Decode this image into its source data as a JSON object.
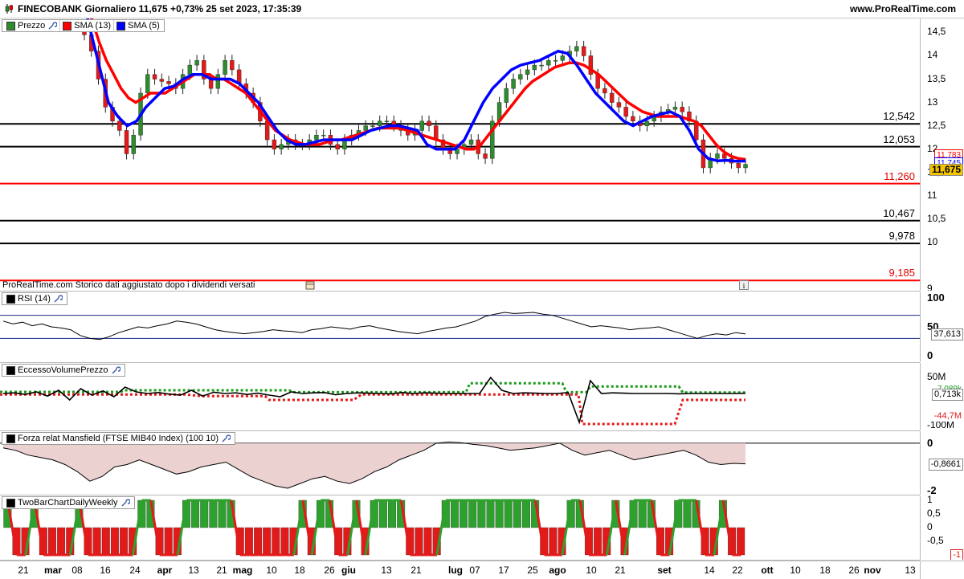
{
  "header": {
    "title": "FINECOBANK Giornaliero 11,675 +0,73% 25 set 2023, 17:35:39",
    "site": "www.ProRealTime.com"
  },
  "price_panel": {
    "legend": [
      {
        "label": "Prezzo",
        "color": "#2e8b2e"
      },
      {
        "label": "SMA (13)",
        "color": "#ff0000"
      },
      {
        "label": "SMA (5)",
        "color": "#0000ff"
      }
    ],
    "note": "ProRealTime.com  Storico dati aggiustato dopo i dividendi versati",
    "last_price_tag": "11,675",
    "sma13_tag": "11,783",
    "sma5_tag": "11,745"
  },
  "rsi_panel": {
    "legend": "RSI (14)",
    "tag": "37,613"
  },
  "evp_panel": {
    "legend": "EccessoVolumePrezzo",
    "tags": [
      "7,089k",
      "0,713k",
      "-44,7M"
    ]
  },
  "mansfield_panel": {
    "legend": "Forza relat Mansfield (FTSE MIB40 Index) (100 10)",
    "tag": "-0,8661"
  },
  "twobar_panel": {
    "legend": "TwoBarChartDailyWeekly",
    "tag": "-1"
  },
  "date_labels": [
    {
      "t": "21",
      "x": 29,
      "bold": false
    },
    {
      "t": "mar",
      "x": 66,
      "bold": true
    },
    {
      "t": "08",
      "x": 96,
      "bold": false
    },
    {
      "t": "16",
      "x": 131,
      "bold": false
    },
    {
      "t": "24",
      "x": 168,
      "bold": false
    },
    {
      "t": "apr",
      "x": 205,
      "bold": true
    },
    {
      "t": "13",
      "x": 241,
      "bold": false
    },
    {
      "t": "21",
      "x": 276,
      "bold": false
    },
    {
      "t": "mag",
      "x": 302,
      "bold": true
    },
    {
      "t": "10",
      "x": 338,
      "bold": false
    },
    {
      "t": "18",
      "x": 373,
      "bold": false
    },
    {
      "t": "26",
      "x": 410,
      "bold": false
    },
    {
      "t": "giu",
      "x": 434,
      "bold": true
    },
    {
      "t": "13",
      "x": 481,
      "bold": false
    },
    {
      "t": "21",
      "x": 518,
      "bold": false
    },
    {
      "t": "lug",
      "x": 567,
      "bold": true
    },
    {
      "t": "07",
      "x": 591,
      "bold": false
    },
    {
      "t": "17",
      "x": 627,
      "bold": false
    },
    {
      "t": "25",
      "x": 663,
      "bold": false
    },
    {
      "t": "ago",
      "x": 694,
      "bold": true
    },
    {
      "t": "10",
      "x": 736,
      "bold": false
    },
    {
      "t": "21",
      "x": 772,
      "bold": false
    },
    {
      "t": "set",
      "x": 827,
      "bold": true
    },
    {
      "t": "14",
      "x": 883,
      "bold": false
    },
    {
      "t": "22",
      "x": 918,
      "bold": false
    },
    {
      "t": "ott",
      "x": 955,
      "bold": true
    },
    {
      "t": "10",
      "x": 990,
      "bold": false
    },
    {
      "t": "18",
      "x": 1027,
      "bold": false
    },
    {
      "t": "26",
      "x": 1063,
      "bold": false
    },
    {
      "t": "nov",
      "x": 1086,
      "bold": true
    },
    {
      "t": "13",
      "x": 1133,
      "bold": false
    }
  ],
  "chart_data": [
    {
      "type": "candlestick",
      "ylim": [
        9,
        14.8
      ],
      "y_ticks": [
        "14,5",
        "14",
        "13,5",
        "13",
        "12,5",
        "12",
        "11,5",
        "11",
        "10,5",
        "10",
        "9"
      ],
      "y_tick_values": [
        14.5,
        14,
        13.5,
        13,
        12.5,
        12,
        11.5,
        11,
        10.5,
        10,
        9
      ],
      "levels": [
        {
          "value": 12.542,
          "label": "12,542",
          "color": "#000000"
        },
        {
          "value": 12.053,
          "label": "12,053",
          "color": "#000000"
        },
        {
          "value": 11.26,
          "label": "11,260",
          "color": "#ff0000"
        },
        {
          "value": 10.467,
          "label": "10,467",
          "color": "#000000"
        },
        {
          "value": 9.978,
          "label": "9,978",
          "color": "#000000"
        },
        {
          "value": 9.185,
          "label": "9,185",
          "color": "#ff0000"
        }
      ],
      "close": [
        14.45,
        14.1,
        13.5,
        12.9,
        12.6,
        12.4,
        11.9,
        12.3,
        13.2,
        13.6,
        13.5,
        13.45,
        13.4,
        13.3,
        13.6,
        13.8,
        13.9,
        13.5,
        13.3,
        13.6,
        13.9,
        13.7,
        13.4,
        13.2,
        13.0,
        12.6,
        12.2,
        12.0,
        12.1,
        12.2,
        12.1,
        12.1,
        12.2,
        12.3,
        12.3,
        12.1,
        12.0,
        12.2,
        12.3,
        12.4,
        12.5,
        12.5,
        12.6,
        12.6,
        12.5,
        12.4,
        12.3,
        12.4,
        12.6,
        12.5,
        12.2,
        12.0,
        11.9,
        12.0,
        12.1,
        12.2,
        11.9,
        11.8,
        12.6,
        13.0,
        13.3,
        13.5,
        13.6,
        13.7,
        13.8,
        13.8,
        13.9,
        13.9,
        14.0,
        14.1,
        14.2,
        14.0,
        13.6,
        13.3,
        13.2,
        13.0,
        12.9,
        12.7,
        12.6,
        12.5,
        12.6,
        12.7,
        12.8,
        12.85,
        12.9,
        12.8,
        12.6,
        12.2,
        11.6,
        11.8,
        11.9,
        11.8,
        11.7,
        11.6,
        11.675
      ],
      "sma13": [
        15.2,
        14.8,
        14.3,
        13.9,
        13.6,
        13.3,
        13.1,
        13.0,
        13.1,
        13.2,
        13.2,
        13.2,
        13.3,
        13.4,
        13.5,
        13.6,
        13.6,
        13.6,
        13.5,
        13.5,
        13.4,
        13.3,
        13.2,
        13.0,
        12.8,
        12.6,
        12.4,
        12.3,
        12.2,
        12.15,
        12.1,
        12.1,
        12.1,
        12.15,
        12.2,
        12.2,
        12.25,
        12.3,
        12.35,
        12.4,
        12.45,
        12.45,
        12.45,
        12.45,
        12.4,
        12.35,
        12.3,
        12.25,
        12.2,
        12.15,
        12.1,
        12.05,
        12.0,
        12.0,
        12.1,
        12.3,
        12.5,
        12.7,
        12.9,
        13.1,
        13.3,
        13.45,
        13.55,
        13.65,
        13.75,
        13.8,
        13.85,
        13.85,
        13.8,
        13.7,
        13.6,
        13.45,
        13.3,
        13.15,
        13.0,
        12.9,
        12.8,
        12.75,
        12.7,
        12.7,
        12.7,
        12.7,
        12.65,
        12.6,
        12.5,
        12.3,
        12.1,
        11.95,
        11.85,
        11.8,
        11.78
      ],
      "sma5": [
        15.5,
        14.6,
        13.8,
        13.0,
        12.7,
        12.5,
        12.6,
        12.9,
        13.1,
        13.3,
        13.35,
        13.5,
        13.6,
        13.6,
        13.5,
        13.5,
        13.5,
        13.4,
        13.2,
        13.0,
        12.7,
        12.4,
        12.2,
        12.1,
        12.1,
        12.15,
        12.2,
        12.2,
        12.2,
        12.2,
        12.3,
        12.4,
        12.45,
        12.5,
        12.5,
        12.45,
        12.4,
        12.1,
        12.0,
        12.0,
        12.0,
        12.2,
        12.6,
        13.0,
        13.3,
        13.5,
        13.7,
        13.8,
        13.85,
        13.9,
        14.0,
        14.1,
        14.05,
        13.8,
        13.5,
        13.2,
        13.0,
        12.8,
        12.6,
        12.5,
        12.6,
        12.7,
        12.75,
        12.8,
        12.7,
        12.4,
        12.0,
        11.8,
        11.75,
        11.76,
        11.74,
        11.745
      ]
    },
    {
      "type": "line",
      "name": "RSI (14)",
      "ylim": [
        0,
        100
      ],
      "y_ticks": [
        "100",
        "50",
        "0"
      ],
      "y_tick_values": [
        100,
        50,
        0
      ],
      "levels": [
        70,
        30
      ],
      "values": [
        60,
        55,
        58,
        52,
        55,
        50,
        48,
        45,
        35,
        30,
        28,
        33,
        40,
        45,
        50,
        48,
        52,
        55,
        60,
        58,
        55,
        50,
        45,
        42,
        40,
        38,
        40,
        42,
        45,
        43,
        42,
        40,
        45,
        47,
        50,
        48,
        46,
        50,
        52,
        48,
        45,
        42,
        40,
        38,
        42,
        45,
        48,
        50,
        55,
        60,
        68,
        72,
        75,
        73,
        74,
        75,
        72,
        70,
        65,
        60,
        55,
        50,
        52,
        50,
        48,
        45,
        47,
        48,
        50,
        45,
        40,
        35,
        30,
        35,
        38,
        36,
        40,
        37.6
      ]
    },
    {
      "type": "line",
      "name": "EccessoVolumePrezzo",
      "ylim": [
        -100,
        50
      ],
      "y_ticks": [
        "50M",
        "-100M"
      ],
      "y_tick_values": [
        50,
        -100
      ],
      "values": [
        0,
        2,
        -3,
        5,
        -8,
        10,
        -20,
        15,
        -5,
        8,
        -10,
        20,
        5,
        0,
        3,
        -2,
        -5,
        10,
        -8,
        4,
        0,
        2,
        -3,
        1,
        -5,
        -10,
        5,
        0,
        2,
        3,
        -4,
        0,
        2,
        1,
        0,
        -1,
        3,
        0,
        2,
        1,
        0,
        0,
        0,
        0,
        50,
        10,
        0,
        2,
        1,
        0,
        0,
        3,
        -90,
        40,
        0,
        2,
        1,
        0,
        0,
        0,
        0,
        -1,
        0,
        0,
        0,
        0,
        0,
        0.7
      ]
    },
    {
      "type": "area",
      "name": "Forza relat Mansfield",
      "ylim": [
        -2,
        0.2
      ],
      "y_ticks": [
        "0",
        "-2"
      ],
      "y_tick_values": [
        0,
        -2
      ],
      "values": [
        -0.2,
        -0.3,
        -0.5,
        -0.6,
        -0.7,
        -0.9,
        -1.2,
        -1.6,
        -1.4,
        -1.0,
        -0.9,
        -0.7,
        -0.9,
        -1.1,
        -1.3,
        -1.2,
        -1.0,
        -0.9,
        -0.8,
        -1.1,
        -1.4,
        -1.6,
        -1.8,
        -1.9,
        -1.7,
        -1.5,
        -1.4,
        -1.6,
        -1.7,
        -1.5,
        -1.2,
        -1.0,
        -0.7,
        -0.5,
        -0.3,
        0.0,
        0.05,
        0.02,
        -0.05,
        -0.1,
        -0.2,
        -0.3,
        -0.25,
        -0.2,
        -0.1,
        0.0,
        -0.3,
        -0.5,
        -0.4,
        -0.3,
        -0.5,
        -0.7,
        -0.6,
        -0.5,
        -0.4,
        -0.3,
        -0.5,
        -0.8,
        -0.9,
        -0.85,
        -0.87
      ]
    },
    {
      "type": "bar",
      "name": "TwoBarChartDailyWeekly",
      "ylim": [
        -1,
        1
      ],
      "y_ticks": [
        "1",
        "0,5",
        "0",
        "-0,5"
      ],
      "y_tick_values": [
        1,
        0.5,
        0,
        -0.5
      ],
      "values": [
        1,
        -1,
        -1,
        1,
        -1,
        -1,
        -1,
        -1,
        1,
        -1,
        -1,
        -1,
        -1,
        -1,
        -1,
        1,
        1,
        -1,
        -1,
        -1,
        1,
        1,
        1,
        1,
        1,
        1,
        -1,
        -1,
        -1,
        -1,
        -1,
        -1,
        -1,
        1,
        -1,
        1,
        1,
        -1,
        -1,
        1,
        -1,
        1,
        1,
        1,
        1,
        -1,
        -1,
        -1,
        -1,
        1,
        1,
        1,
        1,
        1,
        1,
        1,
        1,
        1,
        1,
        1,
        -1,
        -1,
        -1,
        1,
        1,
        -1,
        -1,
        -1,
        1,
        -1,
        1,
        1,
        1,
        -1,
        -1,
        1,
        1,
        1,
        -1,
        -1,
        1,
        -1,
        -1
      ]
    }
  ]
}
